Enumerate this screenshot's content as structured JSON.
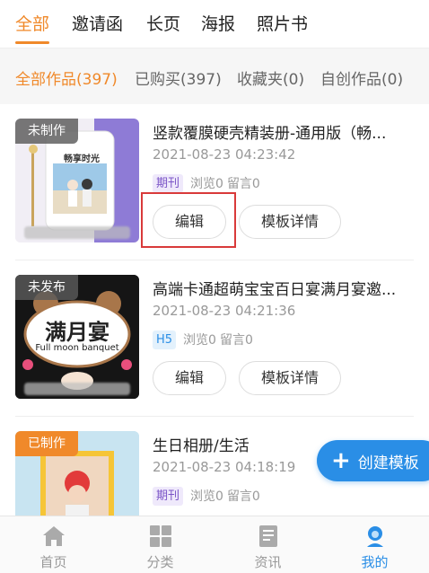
{
  "top_tabs": [
    {
      "label": "全部",
      "active": true
    },
    {
      "label": "邀请函",
      "active": false
    },
    {
      "label": "长页",
      "active": false
    },
    {
      "label": "海报",
      "active": false
    },
    {
      "label": "照片书",
      "active": false
    }
  ],
  "filters": [
    {
      "label": "全部作品(397)",
      "active": true
    },
    {
      "label": "已购买(397)",
      "active": false
    },
    {
      "label": "收藏夹(0)",
      "active": false
    },
    {
      "label": "自创作品(0)",
      "active": false
    }
  ],
  "works": [
    {
      "badge": "未制作",
      "thumb_text": "畅享时光",
      "title": "竖款覆膜硬壳精装册-通用版（畅...",
      "date": "2021-08-23 04:23:42",
      "type": "期刊",
      "views": "浏览0",
      "comments": "留言0",
      "edit_label": "编辑",
      "detail_label": "模板详情"
    },
    {
      "badge": "未发布",
      "thumb_text": "满月宴",
      "thumb_subtext": "Full moon banquet",
      "title": "高端卡通超萌宝宝百日宴满月宴邀...",
      "date": "2021-08-23 04:21:36",
      "type": "H5",
      "views": "浏览0",
      "comments": "留言0",
      "edit_label": "编辑",
      "detail_label": "模板详情"
    },
    {
      "badge": "已制作",
      "title": "生日相册/生活",
      "date": "2021-08-23 04:18:19",
      "type": "期刊",
      "views": "浏览0",
      "comments": "留言0"
    }
  ],
  "fab": {
    "label": "创建模板",
    "icon": "plus-icon"
  },
  "bottom_nav": [
    {
      "label": "首页",
      "icon": "home-icon",
      "active": false
    },
    {
      "label": "分类",
      "icon": "grid-icon",
      "active": false
    },
    {
      "label": "资讯",
      "icon": "news-icon",
      "active": false
    },
    {
      "label": "我的",
      "icon": "user-icon",
      "active": true
    }
  ],
  "colors": {
    "accent_orange": "#f0892a",
    "accent_blue": "#2a8ee6",
    "highlight_red": "#d93a3a"
  }
}
